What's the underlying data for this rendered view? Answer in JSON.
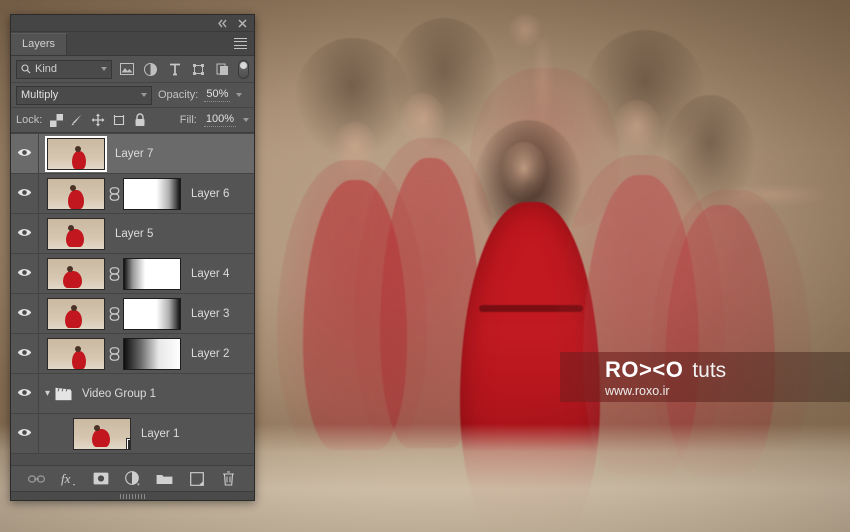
{
  "app": {
    "name": "Adobe Photoshop Layers Panel"
  },
  "panel": {
    "titlebar": {
      "collapse_icon": "double-chevron-left-icon",
      "close_icon": "close-x-icon"
    },
    "tab_label": "Layers",
    "menu_icon": "hamburger-menu-icon",
    "filter": {
      "search_icon": "magnifier-icon",
      "kind_label": "Kind",
      "chevron_icon": "chevron-down-icon",
      "icons": [
        {
          "name": "pixel-layer-filter-icon"
        },
        {
          "name": "adjustment-layer-filter-icon"
        },
        {
          "name": "type-layer-filter-icon"
        },
        {
          "name": "shape-layer-filter-icon"
        },
        {
          "name": "smart-object-filter-icon"
        }
      ],
      "toggle_name": "filter-enable-toggle"
    },
    "blend": {
      "mode": "Multiply",
      "opacity_label": "Opacity:",
      "opacity_value": "50%"
    },
    "lock": {
      "label": "Lock:",
      "icons": [
        {
          "name": "lock-transparent-pixels-icon"
        },
        {
          "name": "lock-image-pixels-icon"
        },
        {
          "name": "lock-position-icon"
        },
        {
          "name": "lock-artboard-nesting-icon"
        },
        {
          "name": "lock-all-icon"
        }
      ],
      "fill_label": "Fill:",
      "fill_value": "100%"
    },
    "layers": [
      {
        "name": "Layer 7",
        "selected": true,
        "has_mask": false,
        "mask_gradient": "",
        "thumb_transparent": false,
        "kind": "pixel",
        "indent": false
      },
      {
        "name": "Layer 6",
        "selected": false,
        "has_mask": true,
        "mask_gradient": "white-to-black-right",
        "thumb_transparent": true,
        "kind": "pixel",
        "indent": false
      },
      {
        "name": "Layer 5",
        "selected": false,
        "has_mask": false,
        "mask_gradient": "",
        "thumb_transparent": false,
        "kind": "pixel",
        "indent": false
      },
      {
        "name": "Layer 4",
        "selected": false,
        "has_mask": true,
        "mask_gradient": "black-to-white-left",
        "thumb_transparent": true,
        "kind": "pixel",
        "indent": false
      },
      {
        "name": "Layer 3",
        "selected": false,
        "has_mask": true,
        "mask_gradient": "white-to-black-right",
        "thumb_transparent": true,
        "kind": "pixel",
        "indent": false
      },
      {
        "name": "Layer 2",
        "selected": false,
        "has_mask": true,
        "mask_gradient": "black-to-white-right",
        "thumb_transparent": true,
        "kind": "pixel",
        "indent": false
      },
      {
        "name": "Video Group 1",
        "selected": false,
        "has_mask": false,
        "mask_gradient": "",
        "thumb_transparent": false,
        "kind": "video-group",
        "indent": false
      },
      {
        "name": "Layer 1",
        "selected": false,
        "has_mask": false,
        "mask_gradient": "",
        "thumb_transparent": false,
        "kind": "video",
        "indent": true
      }
    ],
    "bottom_icons": [
      {
        "name": "link-layers-icon"
      },
      {
        "name": "layer-effects-fx-icon"
      },
      {
        "name": "add-layer-mask-icon"
      },
      {
        "name": "new-adjustment-layer-icon"
      },
      {
        "name": "new-group-folder-icon"
      },
      {
        "name": "new-layer-icon"
      },
      {
        "name": "delete-layer-trash-icon"
      }
    ],
    "resize_grip": "panel-resize-grip"
  },
  "watermark": {
    "brand": "RO><O",
    "suffix": "tuts",
    "url": "www.roxo.ir"
  },
  "colors": {
    "panel_bg": "#535353",
    "panel_row": "#545454",
    "panel_row_selected": "#6a6a6a",
    "text": "#dcdcdc",
    "dress_red": "#c2171f",
    "backdrop": "#b49b81",
    "watermark_red": "#781c1c"
  }
}
